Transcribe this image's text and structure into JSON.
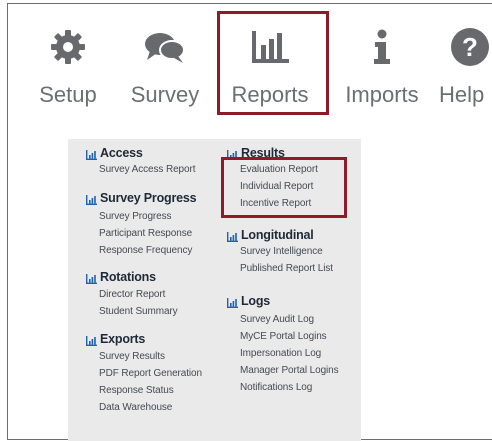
{
  "colors": {
    "nav_text": "#6b6e73",
    "highlight": "#8e1b2a",
    "menu_bg": "#eaeaea",
    "icon_blue": "#1e62b2"
  },
  "nav": [
    {
      "label": "Setup",
      "icon": "gear-icon"
    },
    {
      "label": "Survey",
      "icon": "chat-bubbles-icon"
    },
    {
      "label": "Reports",
      "icon": "bar-chart-icon",
      "highlighted": true
    },
    {
      "label": "Imports",
      "icon": "info-icon"
    },
    {
      "label": "Help",
      "icon": "question-circle-icon"
    }
  ],
  "menu": {
    "left": [
      {
        "title": "Access",
        "links": [
          "Survey Access Report"
        ]
      },
      {
        "title": "Survey Progress",
        "links": [
          "Survey Progress",
          "Participant Response",
          "Response Frequency"
        ]
      },
      {
        "title": "Rotations",
        "links": [
          "Director Report",
          "Student Summary"
        ]
      },
      {
        "title": "Exports",
        "links": [
          "Survey Results",
          "PDF Report Generation",
          "Response Status",
          "Data Warehouse"
        ]
      }
    ],
    "right": [
      {
        "title": "Results",
        "links": [
          "Evaluation Report",
          "Individual Report",
          "Incentive Report"
        ],
        "highlighted": true
      },
      {
        "title": "Longitudinal",
        "links": [
          "Survey Intelligence",
          "Published Report List"
        ]
      },
      {
        "title": "Logs",
        "links": [
          "Survey Audit Log",
          "MyCE Portal Logins",
          "Impersonation Log",
          "Manager Portal Logins",
          "Notifications Log"
        ]
      }
    ]
  }
}
